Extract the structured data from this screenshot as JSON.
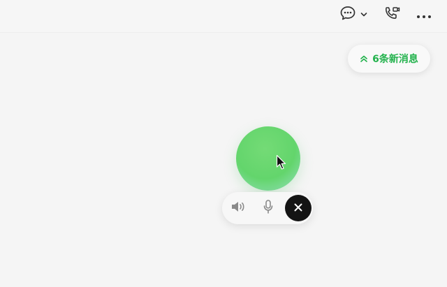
{
  "header": {
    "icons": [
      "chat-bubble-icon",
      "chevron-down-icon",
      "phone-video-call-icon",
      "more-options-icon"
    ]
  },
  "new_messages": {
    "label": "6条新消息",
    "icon": "double-chevron-up-icon",
    "color": "#22b24c"
  },
  "voice_orb": {
    "color": "#63d56c"
  },
  "controls": {
    "icons": [
      "speaker-icon",
      "microphone-icon",
      "close-icon"
    ],
    "close_bg": "#141414"
  }
}
